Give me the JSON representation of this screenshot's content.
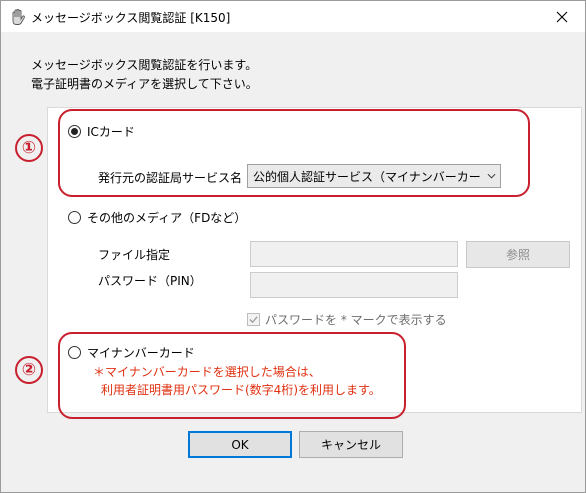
{
  "window": {
    "title": "メッセージボックス閲覧認証 [K150]",
    "icon": "app-hand-icon",
    "close_icon": "close-icon"
  },
  "intro": {
    "line1": "メッセージボックス閲覧認証を行います。",
    "line2": "電子証明書のメディアを選択して下さい。"
  },
  "options": {
    "ic_card": {
      "label": "ICカード",
      "selected": true,
      "service_label": "発行元の認証局サービス名",
      "service_value": "公的個人認証サービス（マイナンバーカー"
    },
    "other_media": {
      "label": "その他のメディア（FDなど）",
      "selected": false,
      "file_label": "ファイル指定",
      "browse_label": "参照",
      "password_label": "パスワード（PIN）",
      "mask_checkbox_label": "パスワードを * マークで表示する",
      "mask_checked": true
    },
    "mynumber": {
      "label": "マイナンバーカード",
      "selected": false,
      "note_line1": "＊マイナンバーカードを選択した場合は、",
      "note_line2": "利用者証明書用パスワード(数字4桁)を利用します。"
    }
  },
  "annotations": {
    "first": "①",
    "second": "②",
    "color": "#c8202e"
  },
  "buttons": {
    "ok": "OK",
    "cancel": "キャンセル"
  },
  "colors": {
    "note": "#e03010",
    "focus": "#0078d7"
  }
}
